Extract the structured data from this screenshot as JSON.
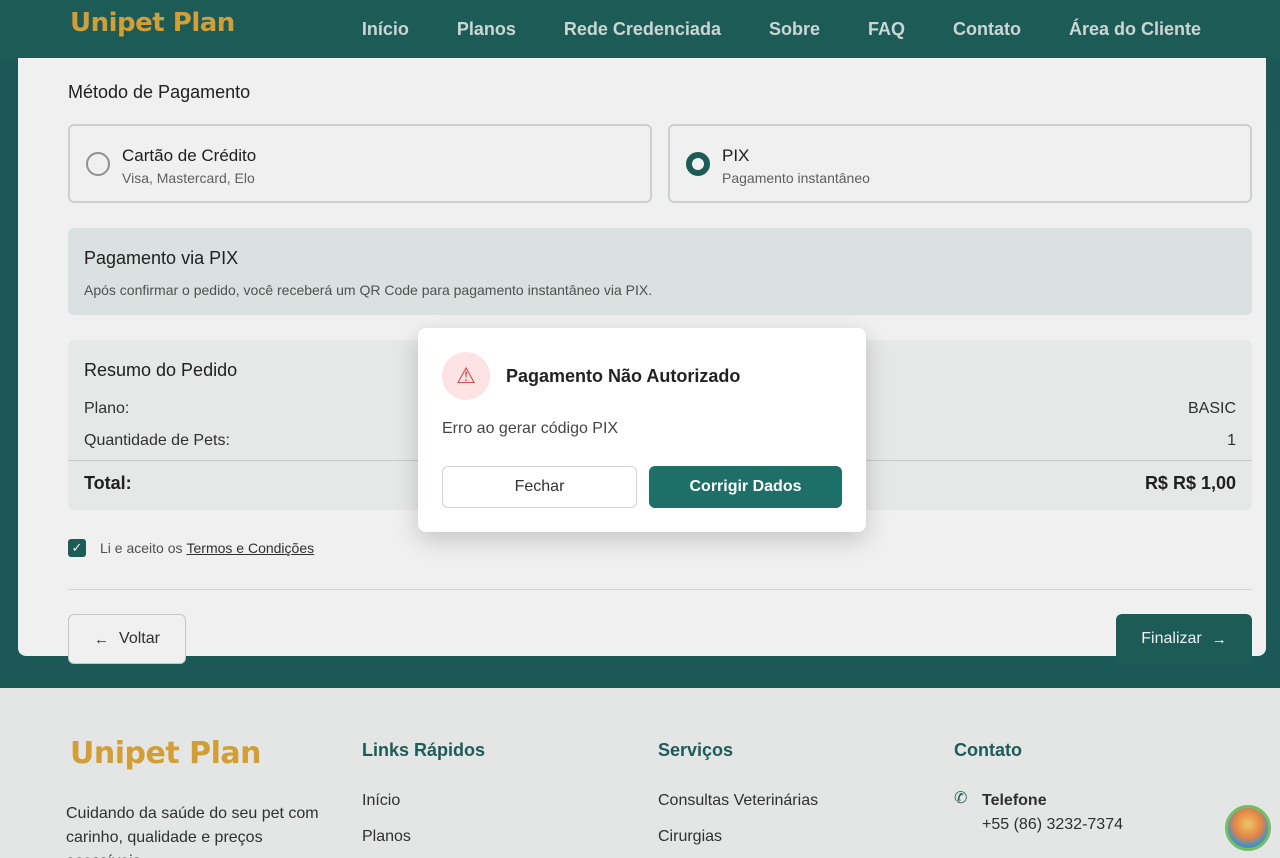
{
  "brand": {
    "name": "Unipet Plan",
    "primary": "#1f615d",
    "accent": "#e0a83a"
  },
  "nav": {
    "items": [
      "Início",
      "Planos",
      "Rede Credenciada",
      "Sobre",
      "FAQ",
      "Contato",
      "Área do Cliente"
    ]
  },
  "payment": {
    "section_title": "Método de Pagamento",
    "options": [
      {
        "label": "Cartão de Crédito",
        "sub": "Visa, Mastercard, Elo",
        "selected": false
      },
      {
        "label": "PIX",
        "sub": "Pagamento instantâneo",
        "selected": true
      }
    ],
    "pix_box": {
      "title": "Pagamento via PIX",
      "text": "Após confirmar o pedido, você receberá um QR Code para pagamento instantâneo via PIX."
    }
  },
  "summary": {
    "title": "Resumo do Pedido",
    "plan_label": "Plano:",
    "plan_value": "BASIC",
    "pets_label": "Quantidade de Pets:",
    "pets_value": "1",
    "total_label": "Total:",
    "total_value": "R$ R$ 1,00"
  },
  "terms": {
    "prefix": "Li e aceito os",
    "link": "Termos e Condições",
    "checked": true
  },
  "actions": {
    "back": "Voltar",
    "next": "Finalizar"
  },
  "modal": {
    "title": "Pagamento Não Autorizado",
    "message": "Erro ao gerar código PIX",
    "close": "Fechar",
    "fix": "Corrigir Dados",
    "icon": "warning-icon"
  },
  "footer": {
    "tagline": "Cuidando da saúde do seu pet com carinho, qualidade e preços acessíveis.",
    "links_title": "Links Rápidos",
    "links": [
      "Início",
      "Planos"
    ],
    "services_title": "Serviços",
    "services": [
      "Consultas Veterinárias",
      "Cirurgias"
    ],
    "contact_title": "Contato",
    "phone_label": "Telefone",
    "phone_value": "+55 (86) 3232-7374"
  }
}
